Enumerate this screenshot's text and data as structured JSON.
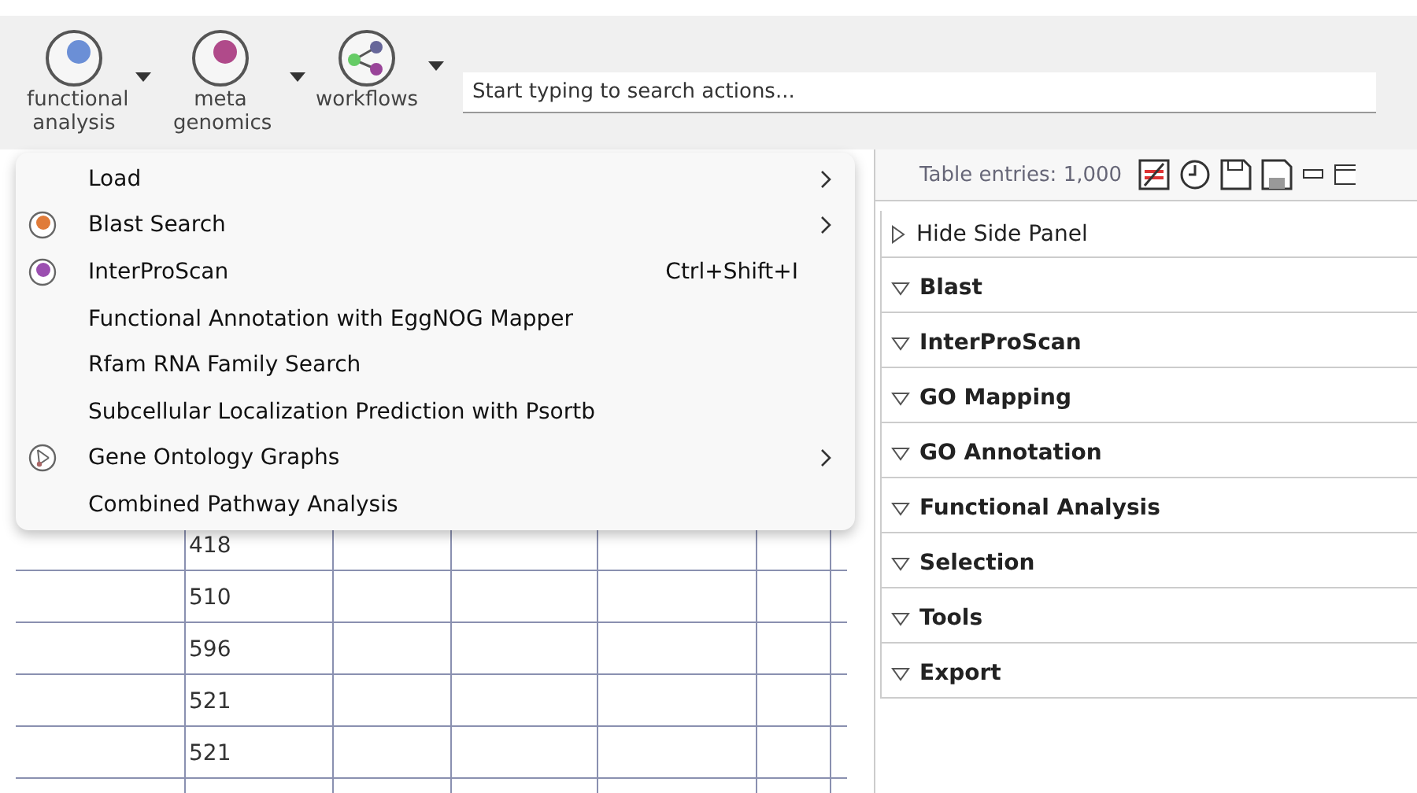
{
  "toolbar": {
    "buttons": [
      {
        "label": "functional analysis",
        "kind": "dot",
        "color": "#6b8fd6"
      },
      {
        "label": "meta genomics",
        "kind": "dot",
        "color": "#b04a8a"
      },
      {
        "label": "workflows",
        "kind": "share"
      }
    ],
    "search": {
      "placeholder": "Start typing to search actions..."
    }
  },
  "menu": {
    "items": [
      {
        "label": "Load",
        "kind": "plain",
        "submenu": true
      },
      {
        "label": "Blast Search",
        "kind": "dot",
        "color": "#e07b39",
        "submenu": true
      },
      {
        "label": "InterProScan",
        "kind": "dot",
        "color": "#9b4fb0",
        "shortcut": "Ctrl+Shift+I",
        "submenu": false
      },
      {
        "label": "Functional Annotation with EggNOG Mapper",
        "kind": "plain",
        "submenu": false
      },
      {
        "label": "Rfam RNA Family Search",
        "kind": "plain",
        "submenu": false
      },
      {
        "label": "Subcellular Localization Prediction with Psortb",
        "kind": "plain",
        "submenu": false
      },
      {
        "label": "Gene Ontology Graphs",
        "kind": "graph",
        "submenu": true
      },
      {
        "label": "Combined Pathway Analysis",
        "kind": "plain",
        "submenu": false
      }
    ]
  },
  "table": {
    "entries": "Table entries: 1,000",
    "rows": [
      {
        "column_2": "418"
      },
      {
        "column_2": "510"
      },
      {
        "column_2": "596"
      },
      {
        "column_2": "521"
      },
      {
        "column_2": "521"
      },
      {
        "column_2": ""
      }
    ]
  },
  "side_panel": {
    "toggle": {
      "label": "Hide Side Panel",
      "expanded": false
    },
    "sections": [
      {
        "label": "Blast",
        "expanded": true
      },
      {
        "label": "InterProScan",
        "expanded": true
      },
      {
        "label": "GO Mapping",
        "expanded": true
      },
      {
        "label": "GO Annotation",
        "expanded": true
      },
      {
        "label": "Functional Analysis",
        "expanded": true
      },
      {
        "label": "Selection",
        "expanded": true
      },
      {
        "label": "Tools",
        "expanded": true
      },
      {
        "label": "Export",
        "expanded": true
      }
    ]
  }
}
